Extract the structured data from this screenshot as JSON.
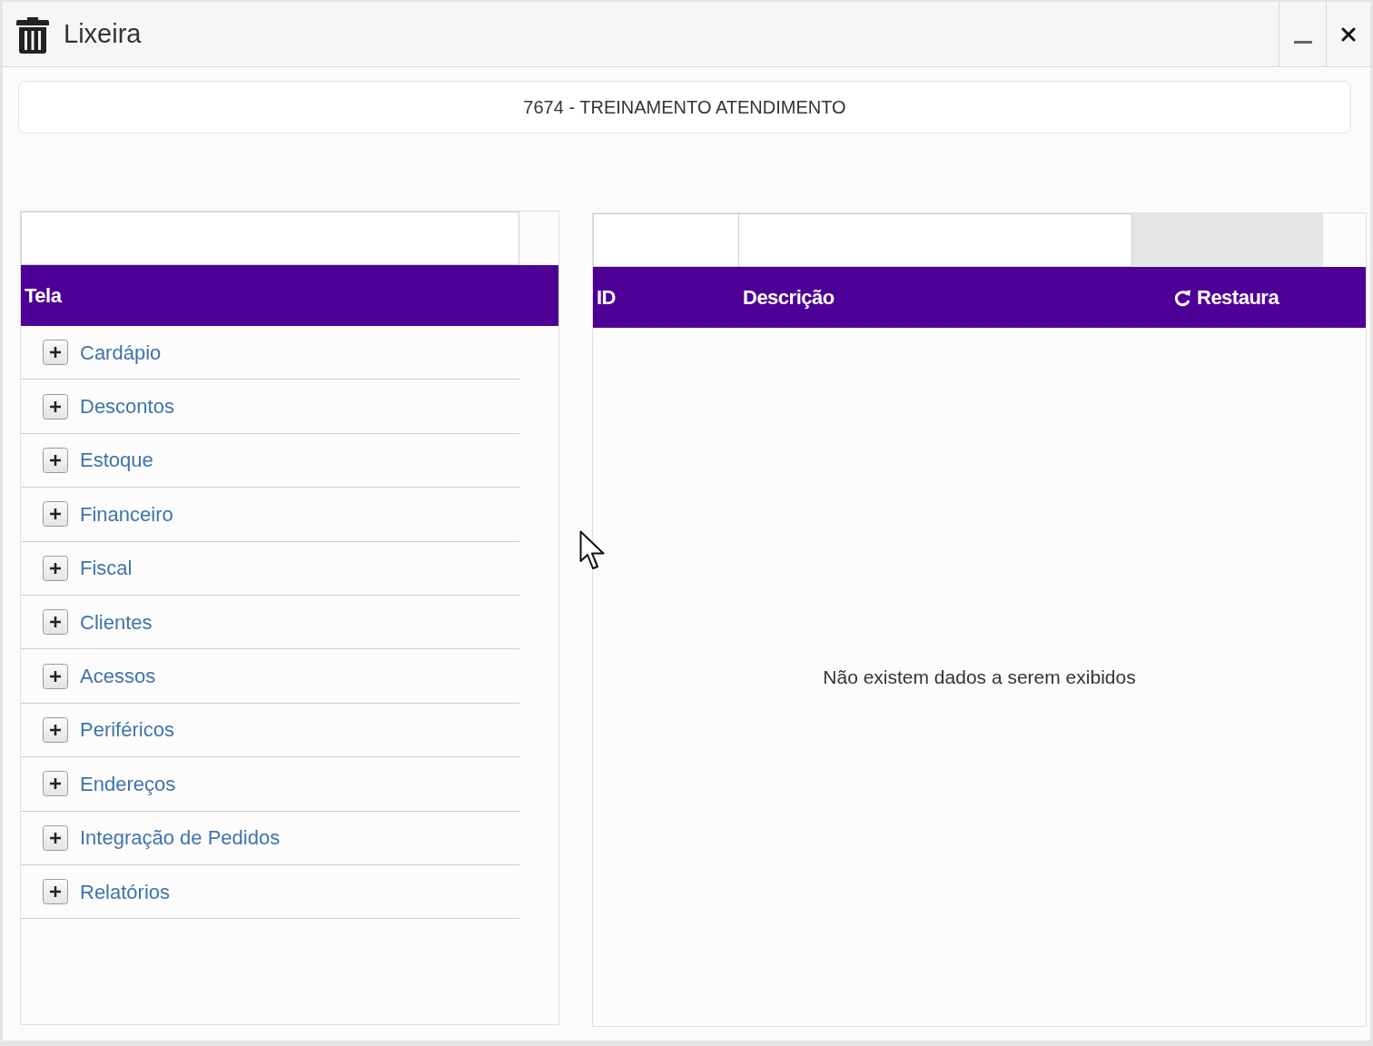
{
  "window": {
    "title": "Lixeira"
  },
  "banner": {
    "text": "7674 - TREINAMENTO ATENDIMENTO"
  },
  "tree_panel": {
    "columns": [
      {
        "label": "Tela"
      }
    ],
    "items": [
      {
        "label": "Cardápio",
        "expanded": false
      },
      {
        "label": "Descontos",
        "expanded": false
      },
      {
        "label": "Estoque",
        "expanded": false
      },
      {
        "label": "Financeiro",
        "expanded": false
      },
      {
        "label": "Fiscal",
        "expanded": false
      },
      {
        "label": "Clientes",
        "expanded": false
      },
      {
        "label": "Acessos",
        "expanded": false
      },
      {
        "label": "Periféricos",
        "expanded": false
      },
      {
        "label": "Endereços",
        "expanded": false
      },
      {
        "label": "Integração de Pedidos",
        "expanded": false
      },
      {
        "label": "Relatórios",
        "expanded": false
      }
    ]
  },
  "grid_panel": {
    "columns": [
      {
        "label": "ID",
        "kind": "text"
      },
      {
        "label": "Descrição",
        "kind": "text"
      },
      {
        "label": "Restaura",
        "kind": "action"
      }
    ],
    "empty_message": "Não existem dados a serem exibidos"
  }
}
